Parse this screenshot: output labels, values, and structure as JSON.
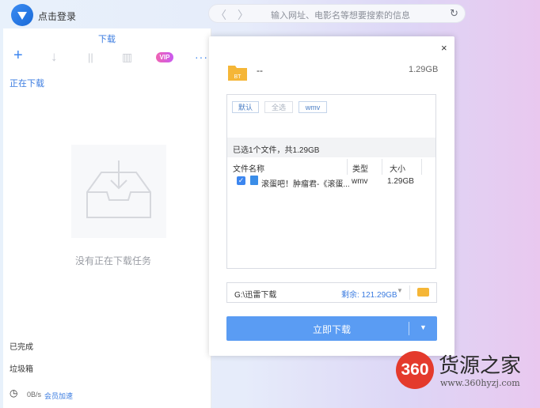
{
  "header": {
    "login_label": "点击登录",
    "back_glyph": "〈",
    "forward_glyph": "〉",
    "address_placeholder": "输入网址、电影名等想要搜索的信息",
    "reload_glyph": "↻"
  },
  "panel": {
    "title": "下载",
    "toolbar": {
      "add_glyph": "+",
      "download_glyph": "↓",
      "pause_glyph": "||",
      "delete_glyph": "▥",
      "vip_label": "VIP",
      "more_glyph": "···"
    },
    "active_tab": "正在下载",
    "empty_message": "没有正在下载任务",
    "completed_label": "已完成",
    "trash_label": "垃圾箱",
    "clock_glyph": "◷",
    "speed": "0B/s",
    "vip_accel": "会员加速"
  },
  "dialog": {
    "close_glyph": "×",
    "folder_badge": "BT",
    "file_name": "--",
    "file_size": "1.29GB",
    "filters": [
      "默认",
      "全选",
      "wmv"
    ],
    "summary": "已选1个文件，共1.29GB",
    "columns": [
      "文件名称",
      "类型",
      "大小"
    ],
    "rows": [
      {
        "checked": true,
        "check_glyph": "✓",
        "name": "滚蛋吧！肿瘤君-《滚蛋...",
        "type": "wmv",
        "size": "1.29GB"
      }
    ],
    "save_path": "G:\\迅雷下载",
    "free_space": "剩余: 121.29GB",
    "path_drop_glyph": "▼",
    "download_button": "立即下载",
    "download_arrow": "▼"
  },
  "watermark": {
    "logo": "360",
    "name": "货源之家",
    "url": "www.360hyzj.com"
  },
  "colors": {
    "accent": "#3c86f0",
    "button": "#5a9cf3",
    "folder": "#f5b637",
    "vip_from": "#f063b2",
    "vip_to": "#c95af0",
    "watermark_red": "#e43a2c"
  }
}
